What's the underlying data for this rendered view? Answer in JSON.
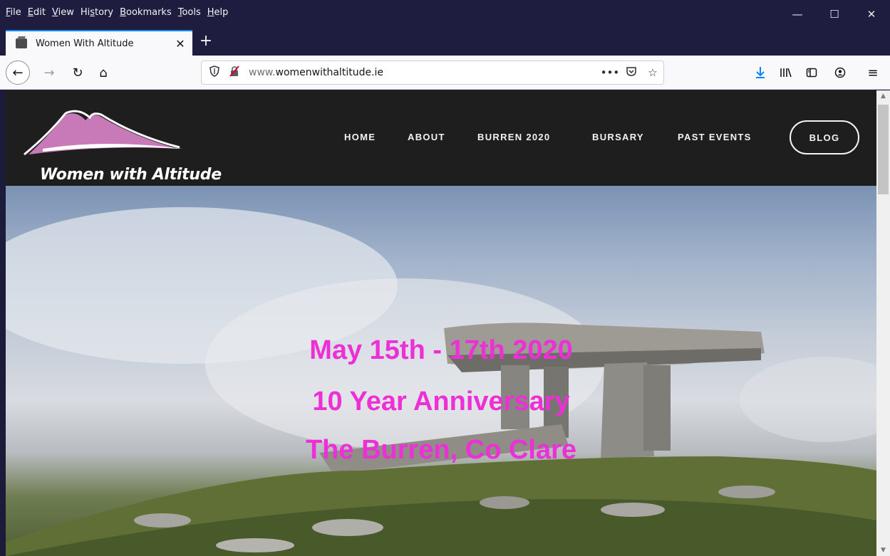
{
  "menubar": {
    "items": [
      {
        "key": "F",
        "rest": "ile"
      },
      {
        "key": "E",
        "rest": "dit"
      },
      {
        "key": "V",
        "rest": "iew"
      },
      {
        "pre": "Hi",
        "key": "s",
        "rest": "tory"
      },
      {
        "key": "B",
        "rest": "ookmarks"
      },
      {
        "key": "T",
        "rest": "ools"
      },
      {
        "key": "H",
        "rest": "elp"
      }
    ]
  },
  "window_controls": {
    "minimize": "—",
    "maximize": "☐",
    "close": "✕"
  },
  "tab": {
    "title": "Women With Altitude",
    "close": "✕",
    "favicon": "cube-icon"
  },
  "new_tab": "+",
  "nav": {
    "back": "←",
    "forward": "→",
    "reload": "↻",
    "home": "⌂",
    "url_prefix": "www.",
    "url_domain": "womenwithaltitude.ie",
    "page_actions": "•••",
    "pocket": "⛉",
    "bookmark": "☆",
    "download": "⤓",
    "library": "|||\\",
    "sidebar": "◫",
    "account": "◉",
    "menu": "≡"
  },
  "site": {
    "logo_text": "Women with Altitude",
    "nav": [
      "HOME",
      "ABOUT",
      "BURREN 2020",
      "BURSARY",
      "PAST EVENTS"
    ],
    "blog_label": "BLOG"
  },
  "hero": {
    "line1": "May 15th - 17th 2020",
    "line2": "10 Year Anniversary",
    "line3": "The Burren, Co Clare",
    "text_color": "#ee2ed6"
  },
  "colors": {
    "chrome_dark": "#1f1d3f",
    "tab_accent": "#0a84ff",
    "site_header": "#1e1e1e"
  }
}
